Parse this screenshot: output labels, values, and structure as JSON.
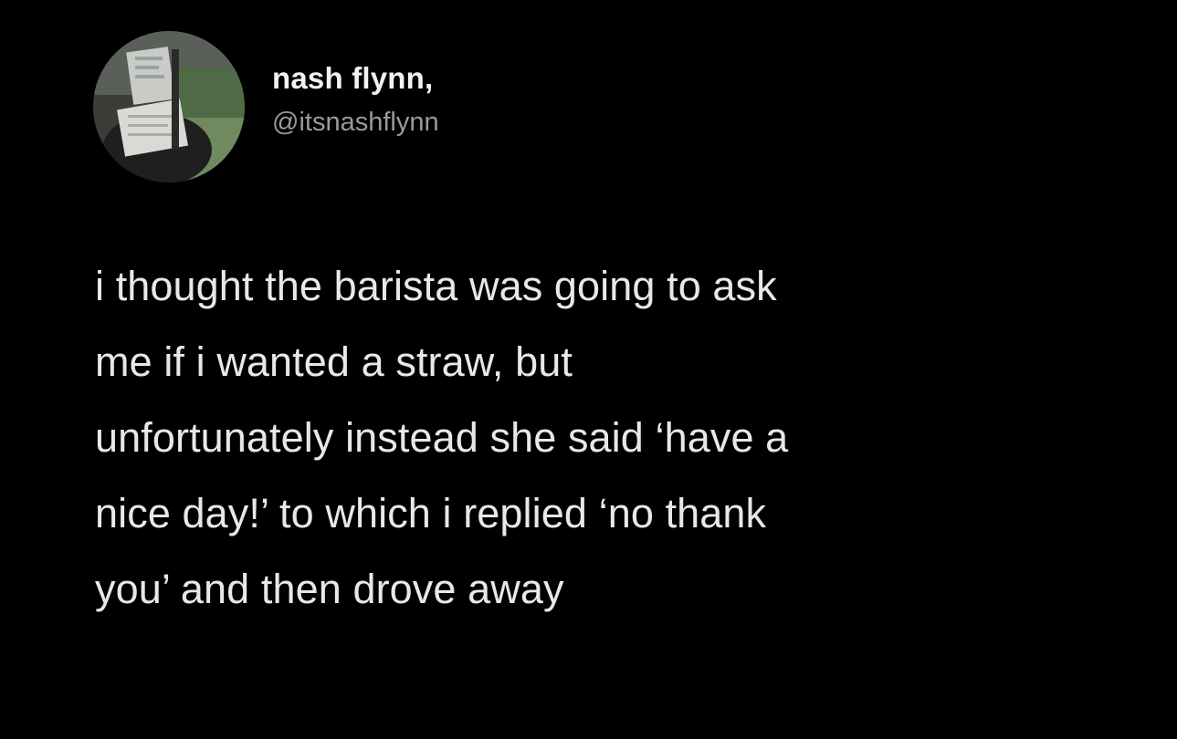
{
  "tweet": {
    "author": {
      "display_name": "nash flynn,",
      "handle": "@itsnashflynn",
      "avatar": "profile-photo"
    },
    "text_lines": [
      "i thought the barista was going to ask",
      "me if i wanted a straw, but",
      "unfortunately instead she said ‘have a",
      "nice day!’ to which i replied ‘no thank",
      "you’ and then drove away"
    ]
  },
  "colors": {
    "background": "#000000",
    "name": "#f2f2f2",
    "handle": "#9a9a9a",
    "text": "#e8e8e8"
  }
}
